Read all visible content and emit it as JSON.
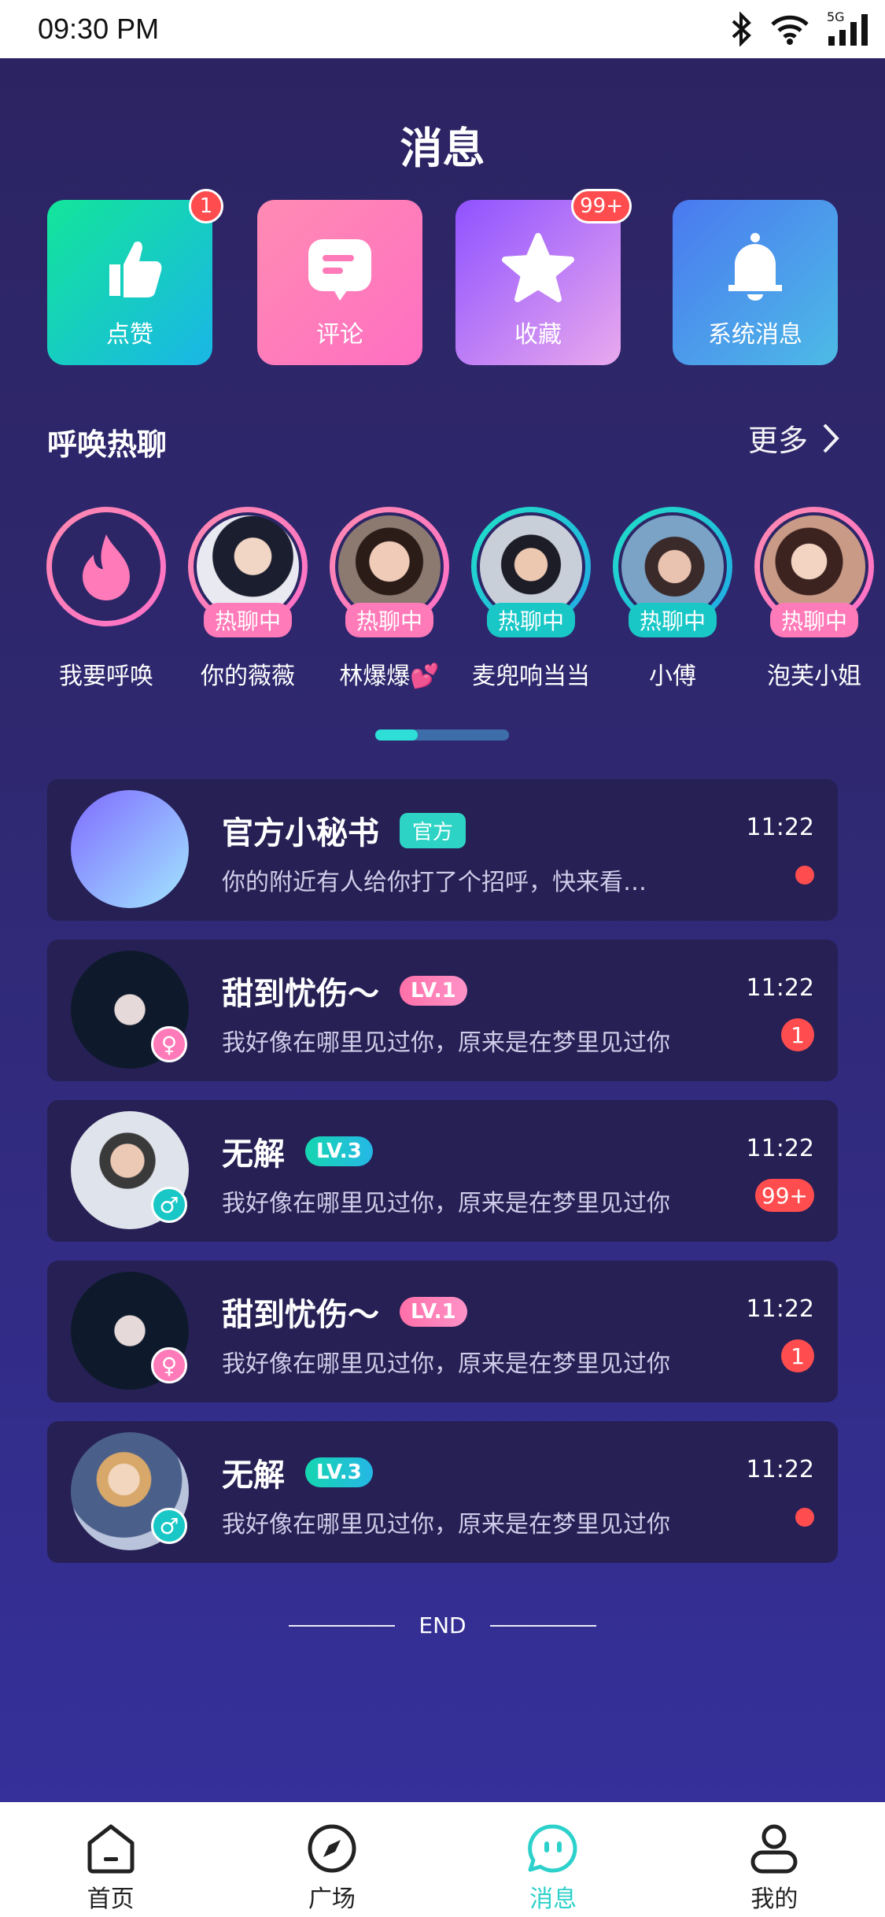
{
  "status_bar": {
    "time": "09:30 PM",
    "network": "5G"
  },
  "page_title": "消息",
  "quick_tiles": [
    {
      "label": "点赞",
      "badge": "1",
      "icon": "thumbs-up-icon"
    },
    {
      "label": "评论",
      "badge": "",
      "icon": "comment-icon"
    },
    {
      "label": "收藏",
      "badge": "99+",
      "icon": "star-icon"
    },
    {
      "label": "系统消息",
      "badge": "",
      "icon": "bell-icon"
    }
  ],
  "hot_section": {
    "title": "呼唤热聊",
    "more": "更多"
  },
  "hot_users": [
    {
      "name": "我要呼唤",
      "status": ""
    },
    {
      "name": "你的薇薇",
      "status": "热聊中"
    },
    {
      "name": "林爆爆💕",
      "status": "热聊中"
    },
    {
      "name": "麦兜响当当",
      "status": "热聊中"
    },
    {
      "name": "小傅",
      "status": "热聊中"
    },
    {
      "name": "泡芙小姐",
      "status": "热聊中"
    }
  ],
  "messages": [
    {
      "name": "官方小秘书",
      "tag": "官方",
      "preview": "你的附近有人给你打了个招呼，快来看…",
      "time": "11:22",
      "count": ""
    },
    {
      "name": "甜到忧伤～",
      "tag": "LV.1",
      "preview": "我好像在哪里见过你，原来是在梦里见过你",
      "time": "11:22",
      "count": "1",
      "gender": "♀"
    },
    {
      "name": "无解",
      "tag": "LV.3",
      "preview": "我好像在哪里见过你，原来是在梦里见过你",
      "time": "11:22",
      "count": "99+",
      "gender": "♂"
    },
    {
      "name": "甜到忧伤～",
      "tag": "LV.1",
      "preview": "我好像在哪里见过你，原来是在梦里见过你",
      "time": "11:22",
      "count": "1",
      "gender": "♀"
    },
    {
      "name": "无解",
      "tag": "LV.3",
      "preview": "我好像在哪里见过你，原来是在梦里见过你",
      "time": "11:22",
      "count": "",
      "gender": "♂"
    }
  ],
  "end_text": "END",
  "tabs": [
    {
      "label": "首页",
      "icon": "home-icon",
      "active": false
    },
    {
      "label": "广场",
      "icon": "compass-icon",
      "active": false
    },
    {
      "label": "消息",
      "icon": "message-icon",
      "active": true
    },
    {
      "label": "我的",
      "icon": "profile-icon",
      "active": false
    }
  ],
  "colors": {
    "accent": "#2dd1cb",
    "badge": "#ff4d4f",
    "background": "#2c2462",
    "card": "#262054"
  }
}
